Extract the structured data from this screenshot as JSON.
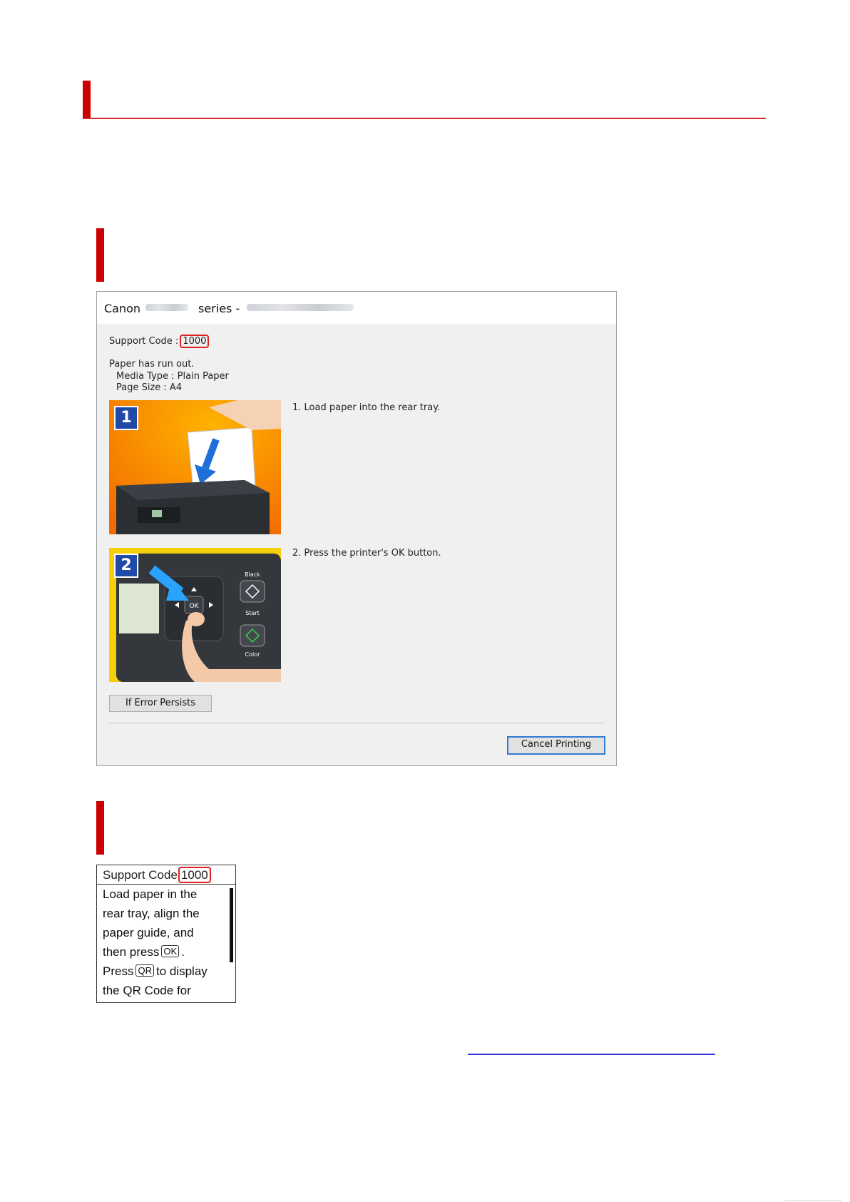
{
  "dialog": {
    "title_brand": "Canon",
    "title_series": "series -",
    "support_code_label": "Support Code :",
    "support_code": "1000",
    "message": "Paper has run out.",
    "media_type": "Media Type : Plain Paper",
    "page_size": "Page Size : A4",
    "steps": [
      {
        "number": "1",
        "text": "1.  Load paper into the rear tray."
      },
      {
        "number": "2",
        "text": "2.  Press the printer's OK button."
      }
    ],
    "panel_labels": {
      "black": "Black",
      "start": "Start",
      "color": "Color",
      "ok": "OK"
    },
    "if_error_label": "If Error Persists",
    "cancel_label": "Cancel Printing"
  },
  "lcd": {
    "support_code_label": "Support Code",
    "support_code": "1000",
    "lines": [
      "Load paper in the",
      "rear tray, align the",
      "paper guide, and",
      "then press",
      ".",
      "Press",
      "to display",
      "the QR Code for"
    ],
    "key_ok": "OK",
    "key_qr": "QR"
  },
  "colors": {
    "accent_red": "#cc0000",
    "button_blue": "#2f7bd6",
    "link_blue": "#3a33d4"
  }
}
